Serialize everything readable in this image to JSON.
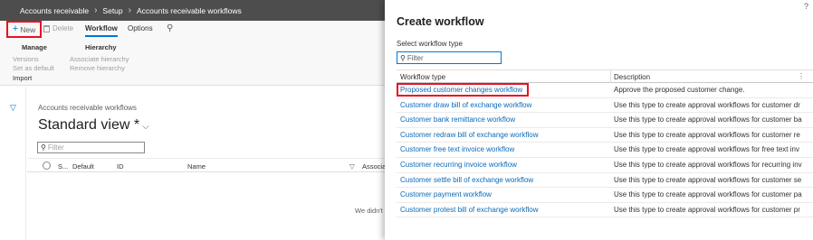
{
  "breadcrumb": [
    "Accounts receivable",
    "Setup",
    "Accounts receivable workflows"
  ],
  "actionpane": {
    "new_label": "New",
    "delete_label": "Delete",
    "tab_workflow": "Workflow",
    "tab_options": "Options",
    "group_manage": "Manage",
    "group_hierarchy": "Hierarchy",
    "versions": "Versions",
    "set_as_default": "Set as default",
    "import": "Import",
    "associate_hierarchy": "Associate hierarchy",
    "remove_hierarchy": "Remove hierarchy"
  },
  "list": {
    "caption": "Accounts receivable workflows",
    "view_name": "Standard view *",
    "filter_placeholder": "Filter",
    "columns": [
      "S...",
      "Default",
      "ID",
      "Name",
      "Associa"
    ],
    "empty_text": "We didn't"
  },
  "dialog": {
    "title": "Create workflow",
    "help": "?",
    "select_label": "Select workflow type",
    "filter_placeholder": "Filter",
    "col_type": "Workflow type",
    "col_description": "Description",
    "rows": [
      {
        "name": "Proposed customer changes workflow",
        "description": "Approve the proposed customer change."
      },
      {
        "name": "Customer draw bill of exchange workflow",
        "description": "Use this type to create approval workflows for customer dr"
      },
      {
        "name": "Customer bank remittance workflow",
        "description": "Use this type to create approval workflows for customer ba"
      },
      {
        "name": "Customer redraw bill of exchange workflow",
        "description": "Use this type to create approval workflows for customer re"
      },
      {
        "name": "Customer free text invoice workflow",
        "description": "Use this type to create approval workflows for free text inv"
      },
      {
        "name": "Customer recurring invoice workflow",
        "description": "Use this type to create approval workflows for recurring inv"
      },
      {
        "name": "Customer settle bill of exchange workflow",
        "description": "Use this type to create approval workflows for customer se"
      },
      {
        "name": "Customer payment workflow",
        "description": "Use this type to create approval workflows for customer pa"
      },
      {
        "name": "Customer protest bill of exchange workflow",
        "description": "Use this type to create approval workflows for customer pr"
      }
    ]
  },
  "colors": {
    "accent": "#0078d4",
    "highlight": "#e81123",
    "topbar": "#4d4d4d",
    "link": "#0b6ab7"
  }
}
